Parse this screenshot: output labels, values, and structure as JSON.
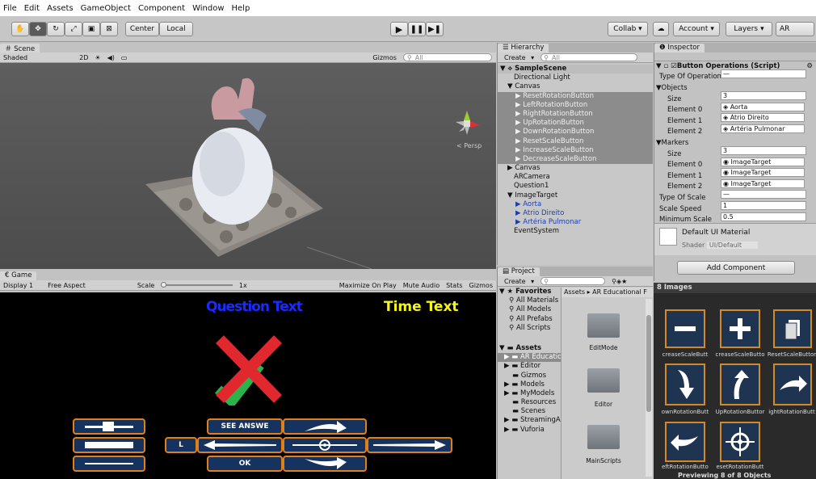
{
  "menu": [
    "File",
    "Edit",
    "Assets",
    "GameObject",
    "Component",
    "Window",
    "Help"
  ],
  "toolbar": {
    "pivot": "Center",
    "space": "Local",
    "collab": "Collab ▾",
    "account": "Account",
    "layers": "Layers",
    "layout": "AR"
  },
  "scene": {
    "tab": "Scene",
    "shaded": "Shaded",
    "mode2d": "2D",
    "gizmos": "Gizmos",
    "search": "All",
    "persp": "< Persp"
  },
  "game": {
    "tab": "Game",
    "display": "Display 1",
    "aspect": "Free Aspect",
    "scale_label": "Scale",
    "scale_value": "1x",
    "opts": [
      "Maximize On Play",
      "Mute Audio",
      "Stats",
      "Gizmos"
    ],
    "question_text": "Question Text",
    "time_text": "Time Text",
    "see_answer": "SEE ANSWE",
    "ok": "OK",
    "l": "L"
  },
  "hierarchy": {
    "tab": "Hierarchy",
    "create": "Create",
    "search": "All",
    "scene": "SampleScene",
    "items": [
      "Directional Light",
      "Canvas",
      "ResetRotationButton",
      "LeftRotationButton",
      "RightRotationButton",
      "UpRotationButton",
      "DownRotationButton",
      "ResetScaleButton",
      "IncreaseScaleButton",
      "DecreaseScaleButton",
      "Canvas",
      "ARCamera",
      "Question1",
      "ImageTarget",
      "Aorta",
      "Átrio Direito",
      "Artéria Pulmonar",
      "EventSystem"
    ]
  },
  "project": {
    "tab": "Project",
    "create": "Create",
    "favorites": "Favorites",
    "fav_items": [
      "All Materials",
      "All Models",
      "All Prefabs",
      "All Scripts"
    ],
    "assets": "Assets",
    "asset_items": [
      "AR Educatio",
      "Editor",
      "Gizmos",
      "Models",
      "MyModels",
      "Resources",
      "Scenes",
      "StreamingA",
      "Vuforia"
    ],
    "breadcrumb": "Assets ▸ AR Educational F",
    "folders": [
      "EditMode",
      "Editor",
      "MainScripts"
    ]
  },
  "inspector": {
    "tab": "Inspector",
    "component": "Button Operations (Script)",
    "type_of_operation_label": "Type Of Operation",
    "type_of_operation": "—",
    "objects": "Objects",
    "size_label": "Size",
    "objects_size": "3",
    "obj_elements": [
      {
        "label": "Element 0",
        "value": "Aorta"
      },
      {
        "label": "Element 1",
        "value": "Átrio Direito"
      },
      {
        "label": "Element 2",
        "value": "Artéria Pulmonar"
      }
    ],
    "markers": "Markers",
    "markers_size": "3",
    "marker_elements": [
      {
        "label": "Element 0",
        "value": "ImageTarget"
      },
      {
        "label": "Element 1",
        "value": "ImageTarget"
      },
      {
        "label": "Element 2",
        "value": "ImageTarget"
      }
    ],
    "type_of_scale_label": "Type Of Scale",
    "type_of_scale": "—",
    "scale_speed_label": "Scale Speed",
    "scale_speed": "1",
    "min_scale_label": "Minimum Scale",
    "min_scale": "0.5",
    "material": "Default UI Material",
    "shader_label": "Shader",
    "shader": "UI/Default",
    "add_component": "Add Component"
  },
  "images": {
    "title": "8 Images",
    "labels": [
      "creaseScaleButt",
      "creaseScaleButto",
      "ResetScaleButtor",
      "ownRotationButt",
      "UpRotationButtor",
      "ightRotationButt",
      "eftRotationButto",
      "esetRotationButt"
    ],
    "footer": "Previewing 8 of 8 Objects"
  },
  "colors": {
    "question": "#1a2bff",
    "time": "#f5f51a",
    "orange": "#e0801a",
    "navy": "#15335e"
  }
}
